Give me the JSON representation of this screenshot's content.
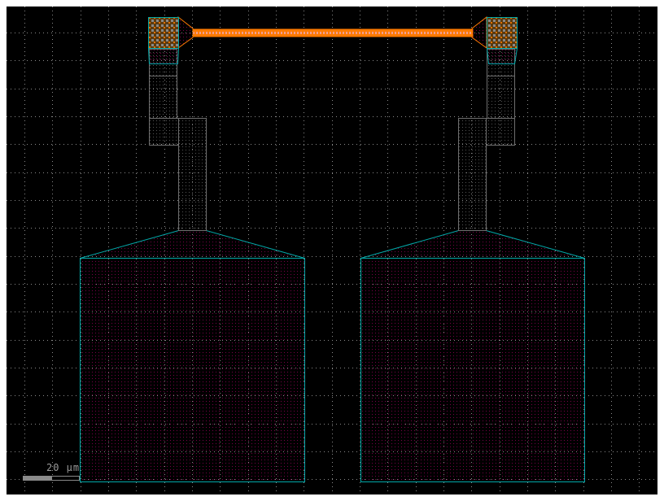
{
  "scale_bar": {
    "label": "20 µm"
  },
  "colors": {
    "background": "#000000",
    "grid": "#8a8a8a",
    "outline": "#00a8a8",
    "metal_outline": "#6e6e6e",
    "waveguide": "#ff7a00",
    "fill_dots": "#a0005a"
  }
}
